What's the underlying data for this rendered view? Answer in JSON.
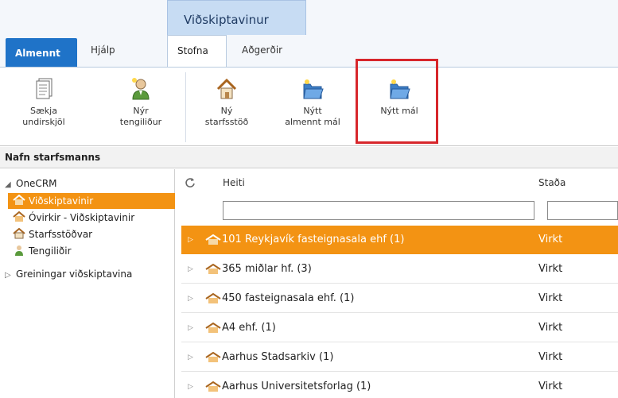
{
  "ribbon_header": {
    "context_title": "Viðskiptavinur",
    "tabs": [
      "Almennt",
      "Hjálp",
      "Stofna",
      "Aðgerðir"
    ]
  },
  "ribbon_buttons": {
    "saekja": "Sækja\nundirskjöl",
    "nyr_tengilidur": "Nýr\ntengiliður",
    "ny_starfsstod": "Ný\nstarfsstöð",
    "nytt_almennt_mal": "Nýtt\nalmennt mál",
    "nytt_mal": "Nýtt mál"
  },
  "section_label": "Nafn starfsmanns",
  "sidebar": {
    "root": "OneCRM",
    "items": [
      "Viðskiptavinir",
      "Óvirkir - Viðskiptavinir",
      "Starfsstöðvar",
      "Tengiliðir"
    ],
    "group": "Greiningar viðskiptavina"
  },
  "grid": {
    "columns": [
      "Heiti",
      "Staða"
    ],
    "rows": [
      {
        "name": "101 Reykjavík fasteignasala ehf (1)",
        "status": "Virkt"
      },
      {
        "name": "365 miðlar hf. (3)",
        "status": "Virkt"
      },
      {
        "name": "450 fasteignasala ehf. (1)",
        "status": "Virkt"
      },
      {
        "name": "A4 ehf. (1)",
        "status": "Virkt"
      },
      {
        "name": "Aarhus Stadsarkiv (1)",
        "status": "Virkt"
      },
      {
        "name": "Aarhus Universitetsforlag (1)",
        "status": "Virkt"
      }
    ]
  },
  "colors": {
    "accent": "#f39313",
    "tab_blue": "#1f73c8",
    "highlight_red": "#d7262b"
  }
}
